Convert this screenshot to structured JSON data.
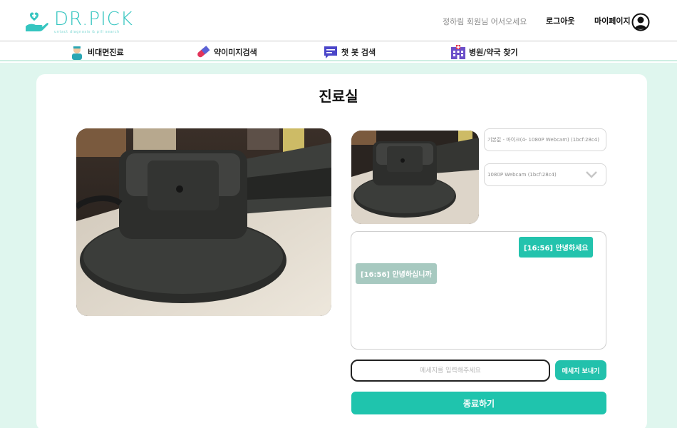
{
  "header": {
    "logo_title": "DR.PICK",
    "logo_subtitle": "untact diagnosis & pill search",
    "greeting": "정하림 회원님 어서오세요",
    "logout_label": "로그아웃",
    "mypage_label": "마이페이지"
  },
  "nav": {
    "items": [
      {
        "label": "비대면진료",
        "icon": "doctor-icon"
      },
      {
        "label": "약이미지검색",
        "icon": "pill-icon"
      },
      {
        "label": "챗 봇 검색",
        "icon": "chat-icon"
      },
      {
        "label": "병원/약국 찾기",
        "icon": "hospital-icon"
      }
    ]
  },
  "main": {
    "title": "진료실",
    "mic_select": "기본값 - 마이크(4- 1080P Webcam) (1bcf:28c4)",
    "camera_select": "1080P Webcam (1bcf:28c4)",
    "messages": [
      {
        "from": "me",
        "text": "[16:56] 안녕하세요"
      },
      {
        "from": "other",
        "text": "[16:56] 안녕하십니까"
      }
    ],
    "input_placeholder": "메세지를 입력해주세요",
    "send_label": "메세지 보내기",
    "end_label": "종료하기"
  },
  "colors": {
    "brand": "#35c5c0",
    "accent": "#1fc4ad",
    "background": "#dff6ee"
  }
}
